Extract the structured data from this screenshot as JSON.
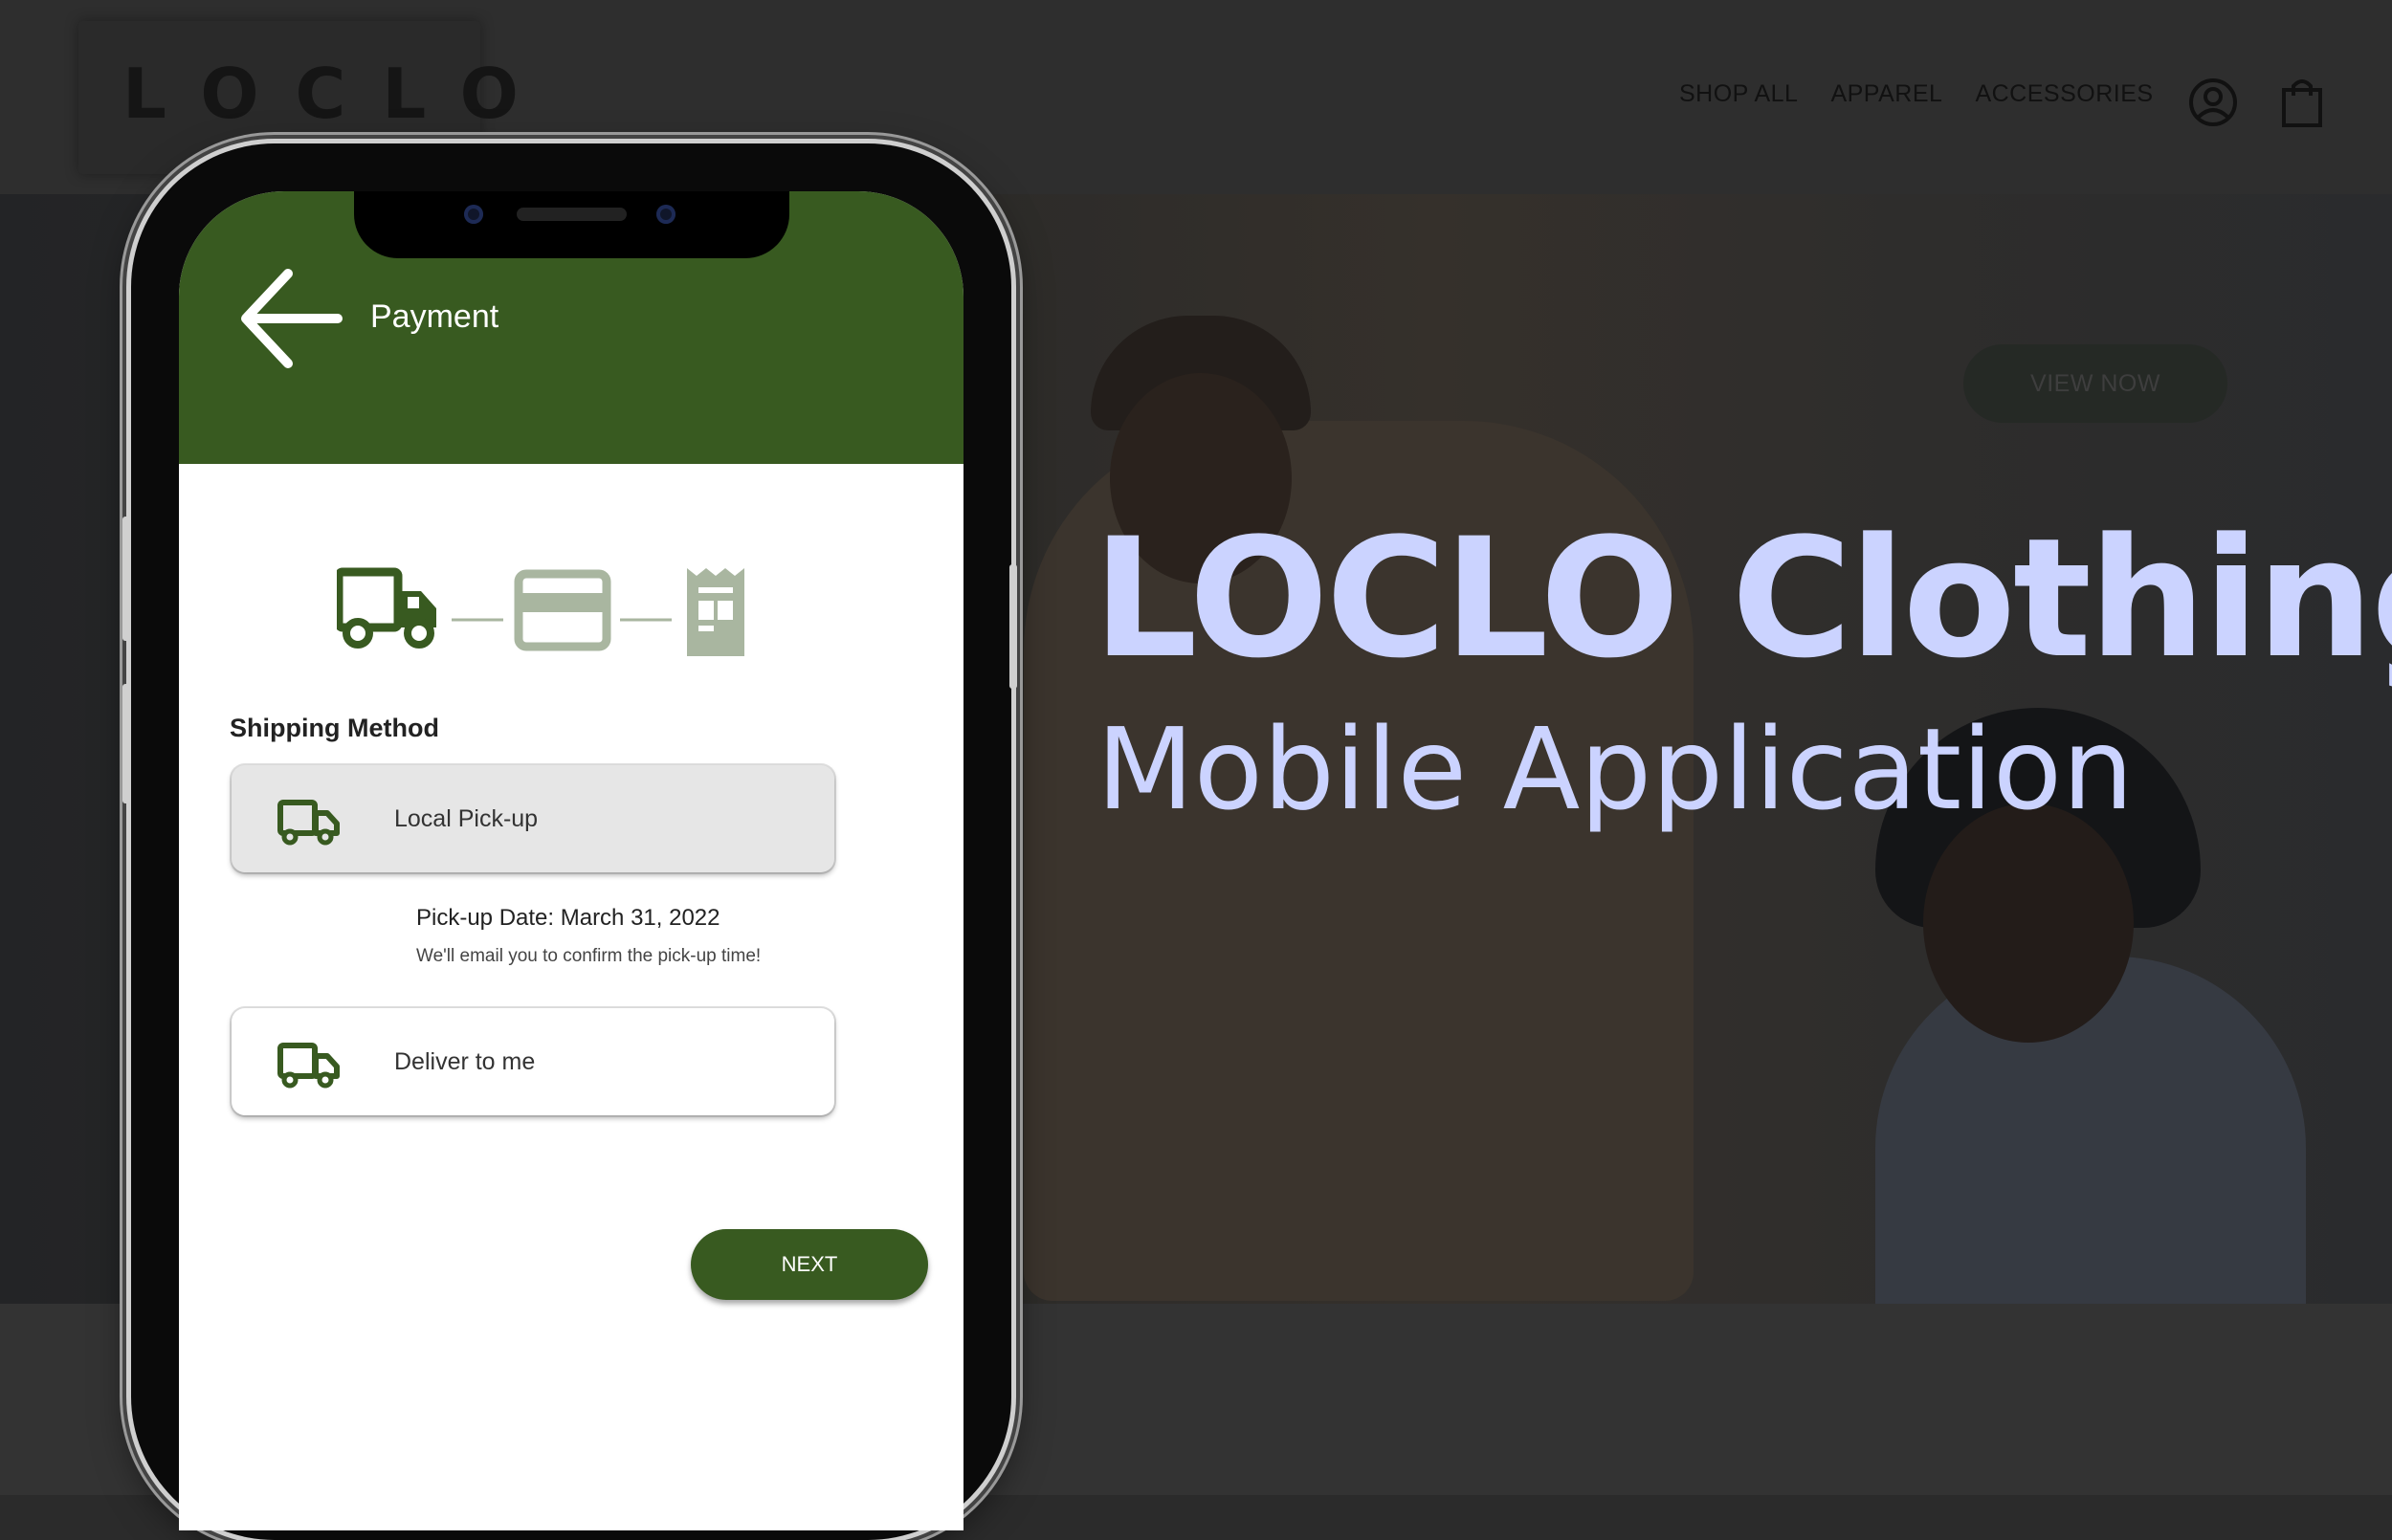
{
  "site": {
    "logo": "LOCLO",
    "nav": [
      "SHOP ALL",
      "APPAREL",
      "ACCESSORIES"
    ],
    "hero_button": "VIEW NOW",
    "icons": [
      "account-icon",
      "shopping-bag-icon"
    ]
  },
  "headline": {
    "title": "LOCLO Clothing",
    "subtitle": "Mobile Application"
  },
  "app": {
    "header_title": "Payment",
    "steps": [
      "truck-icon",
      "credit-card-icon",
      "receipt-icon"
    ],
    "shipping_label": "Shipping Method",
    "options": [
      {
        "label": "Local Pick-up",
        "selected": true
      },
      {
        "label": "Deliver to me",
        "selected": false
      }
    ],
    "pickup_date": "Pick-up Date: March 31, 2022",
    "pickup_note": "We'll email you to confirm the pick-up time!",
    "next_label": "NEXT"
  },
  "colors": {
    "brand_green": "#385a20",
    "headline": "#cbd3ff",
    "muted_step": "#a9b6a0"
  }
}
